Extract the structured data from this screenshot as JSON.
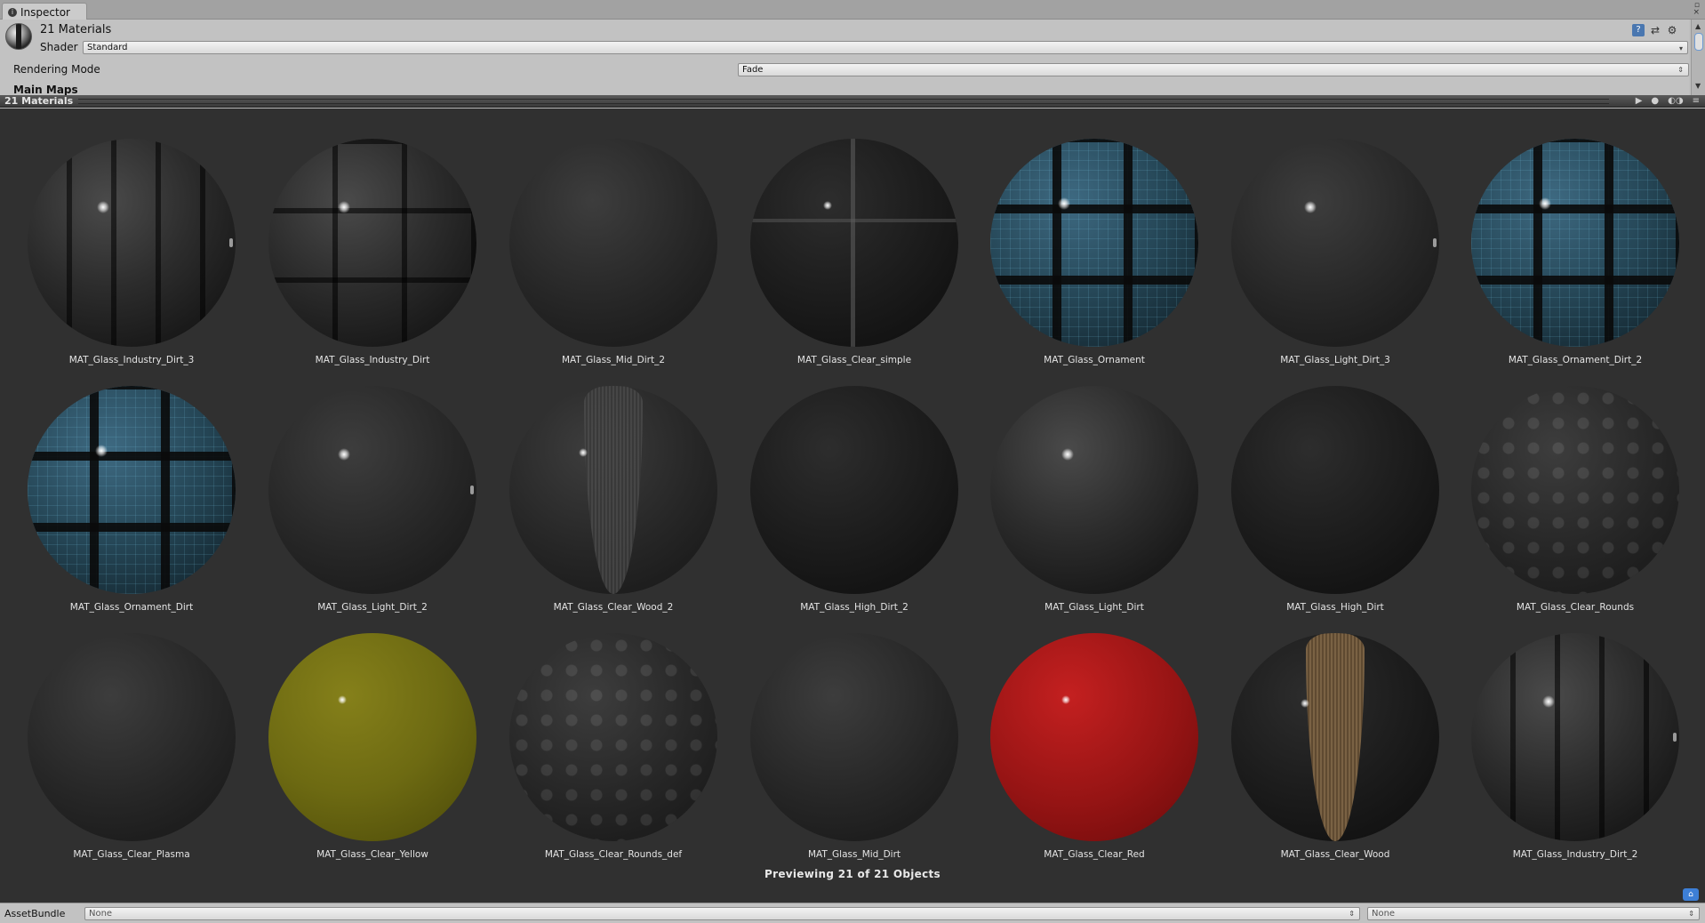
{
  "tab": {
    "label": "Inspector",
    "icon": "info-icon"
  },
  "header": {
    "title": "21 Materials",
    "shader_label": "Shader",
    "shader_value": "Standard"
  },
  "properties": {
    "rendering_mode_label": "Rendering Mode",
    "rendering_mode_value": "Fade",
    "section_label": "Main Maps"
  },
  "preview": {
    "title": "21 Materials",
    "status": "Previewing 21 of 21 Objects",
    "materials": [
      {
        "name": "MAT_Glass_Industry_Dirt_3"
      },
      {
        "name": "MAT_Glass_Industry_Dirt"
      },
      {
        "name": "MAT_Glass_Mid_Dirt_2"
      },
      {
        "name": "MAT_Glass_Clear_simple"
      },
      {
        "name": "MAT_Glass_Ornament"
      },
      {
        "name": "MAT_Glass_Light_Dirt_3"
      },
      {
        "name": "MAT_Glass_Ornament_Dirt_2"
      },
      {
        "name": "MAT_Glass_Ornament_Dirt"
      },
      {
        "name": "MAT_Glass_Light_Dirt_2"
      },
      {
        "name": "MAT_Glass_Clear_Wood_2"
      },
      {
        "name": "MAT_Glass_High_Dirt_2"
      },
      {
        "name": "MAT_Glass_Light_Dirt"
      },
      {
        "name": "MAT_Glass_High_Dirt"
      },
      {
        "name": "MAT_Glass_Clear_Rounds"
      },
      {
        "name": "MAT_Glass_Clear_Plasma"
      },
      {
        "name": "MAT_Glass_Clear_Yellow"
      },
      {
        "name": "MAT_Glass_Clear_Rounds_def"
      },
      {
        "name": "MAT_Glass_Mid_Dirt"
      },
      {
        "name": "MAT_Glass_Clear_Red"
      },
      {
        "name": "MAT_Glass_Clear_Wood"
      },
      {
        "name": "MAT_Glass_Industry_Dirt_2"
      }
    ]
  },
  "asset_bundle": {
    "label": "AssetBundle",
    "bundle_value": "None",
    "variant_value": "None"
  },
  "colors": {
    "preview_bg": "#303030",
    "panel_bg": "#c2c2c2",
    "accent": "#3d7fd6"
  }
}
